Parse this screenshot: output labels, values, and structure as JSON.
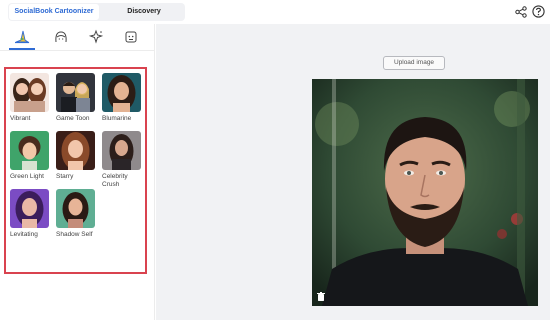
{
  "header": {
    "tabs": [
      {
        "label": "SocialBook Cartoonizer",
        "active": true
      },
      {
        "label": "Discovery",
        "active": false
      }
    ],
    "icons": [
      "share-icon",
      "help-icon"
    ]
  },
  "sidebar": {
    "category_icons": [
      "witch-hat-icon",
      "face-outline-icon",
      "sparkle-face-icon",
      "robot-face-icon"
    ],
    "styles": [
      {
        "label": "Vibrant"
      },
      {
        "label": "Game Toon"
      },
      {
        "label": "Blumarine"
      },
      {
        "label": "Green Light"
      },
      {
        "label": "Starry"
      },
      {
        "label": "Celebrity\nCrush"
      },
      {
        "label": "Levitating"
      },
      {
        "label": "Shadow Self"
      }
    ]
  },
  "main": {
    "upload_label": "Upload image",
    "image_icon": "trash-icon"
  },
  "colors": {
    "accent": "#2f6bd4",
    "highlight_border": "#d9434f"
  }
}
